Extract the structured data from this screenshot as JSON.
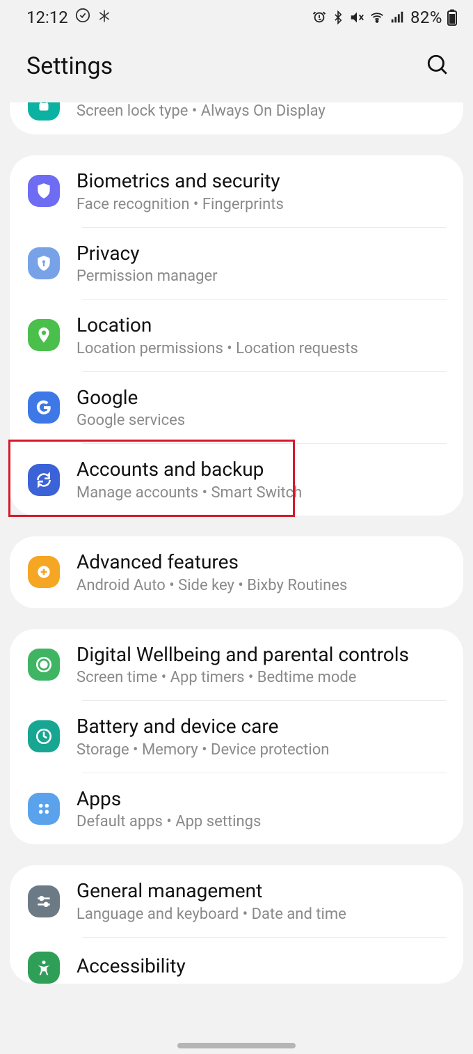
{
  "status": {
    "time": "12:12",
    "battery": "82%"
  },
  "header": {
    "title": "Settings"
  },
  "groups": [
    {
      "partial_top": true,
      "items": [
        {
          "id": "lockscreen",
          "icon": "lock",
          "color": "#0cb2a1",
          "title": "",
          "sub": "Screen lock type  •  Always On Display",
          "truncated_top": true
        }
      ]
    },
    {
      "items": [
        {
          "id": "biometrics",
          "icon": "shield",
          "color": "#6d6cf3",
          "title": "Biometrics and security",
          "sub": "Face recognition  •  Fingerprints"
        },
        {
          "id": "privacy",
          "icon": "privacy",
          "color": "#78a2e8",
          "title": "Privacy",
          "sub": "Permission manager"
        },
        {
          "id": "location",
          "icon": "pin",
          "color": "#4bbf4b",
          "title": "Location",
          "sub": "Location permissions  •  Location requests"
        },
        {
          "id": "google",
          "icon": "google",
          "color": "#3d78e6",
          "title": "Google",
          "sub": "Google services"
        },
        {
          "id": "accounts-backup",
          "icon": "sync",
          "color": "#3c62d8",
          "title": "Accounts and backup",
          "sub": "Manage accounts  •  Smart Switch",
          "highlighted": true
        }
      ]
    },
    {
      "items": [
        {
          "id": "advanced-features",
          "icon": "gear-plus",
          "color": "#f5a623",
          "title": "Advanced features",
          "sub": "Android Auto  •  Side key  •  Bixby Routines"
        }
      ]
    },
    {
      "items": [
        {
          "id": "digital-wellbeing",
          "icon": "wellbeing",
          "color": "#3fb563",
          "title": "Digital Wellbeing and parental controls",
          "sub": "Screen time  •  App timers  •  Bedtime mode"
        },
        {
          "id": "battery-care",
          "icon": "care",
          "color": "#17a692",
          "title": "Battery and device care",
          "sub": "Storage  •  Memory  •  Device protection"
        },
        {
          "id": "apps",
          "icon": "apps",
          "color": "#5aa3ec",
          "title": "Apps",
          "sub": "Default apps  •  App settings"
        }
      ]
    },
    {
      "partial_bottom": true,
      "items": [
        {
          "id": "general-management",
          "icon": "sliders",
          "color": "#6c7a85",
          "title": "General management",
          "sub": "Language and keyboard  •  Date and time"
        },
        {
          "id": "accessibility",
          "icon": "a11y",
          "color": "#2f9e57",
          "title": "Accessibility",
          "sub": "",
          "truncated_bottom": true
        }
      ]
    }
  ],
  "highlight": {
    "target_id": "accounts-backup"
  }
}
